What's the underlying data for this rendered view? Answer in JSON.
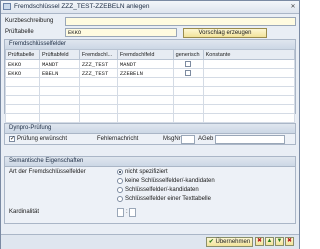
{
  "window": {
    "title": "Fremdschlüssel ZZZ_TEST-ZZEBELN anlegen"
  },
  "form": {
    "short_desc_label": "Kurzbeschreibung",
    "short_desc_value": "",
    "check_table_label": "Prüftabelle",
    "check_table_value": "EKKO",
    "proposal_button": "Vorschlag erzeugen"
  },
  "fk_fields": {
    "header": "Fremdschlüsselfelder",
    "columns": [
      "Prüftabelle",
      "Prüftabfeld",
      "Fremdschl...",
      "Fremdschlfeld",
      "generisch",
      "Konstante"
    ],
    "rows": [
      [
        "EKKO",
        "MANDT",
        "ZZZ_TEST",
        "MANDT",
        "",
        ""
      ],
      [
        "EKKO",
        "EBELN",
        "ZZZ_TEST",
        "ZZEBELN",
        "",
        ""
      ],
      [
        "",
        "",
        "",
        "",
        "",
        ""
      ],
      [
        "",
        "",
        "",
        "",
        "",
        ""
      ],
      [
        "",
        "",
        "",
        "",
        "",
        ""
      ],
      [
        "",
        "",
        "",
        "",
        "",
        ""
      ],
      [
        "",
        "",
        "",
        "",
        "",
        ""
      ]
    ]
  },
  "dynpro": {
    "header": "Dynpro-Prüfung",
    "check_label": "Prüfung erwünscht",
    "check_checked": true,
    "msg_label": "Fehlernachricht",
    "msgno_label": "MsgNr",
    "aarea_label": "AGeb"
  },
  "semantic": {
    "header": "Semantische Eigenschaften",
    "art_label": "Art der Fremdschlüsselfelder",
    "options": [
      "nicht spezifiziert",
      "keine Schlüsselfelder/-kandidaten",
      "Schlüsselfelder/-kandidaten",
      "Schlüsselfelder einer Texttabelle"
    ],
    "selected": 0,
    "card_label": "Kardinalität",
    "card_left": "",
    "card_sep": ":",
    "card_right": ""
  },
  "footer": {
    "ok_label": "Übernehmen",
    "icons": [
      "delete-icon",
      "up-icon",
      "down-icon",
      "cancel-icon"
    ]
  }
}
